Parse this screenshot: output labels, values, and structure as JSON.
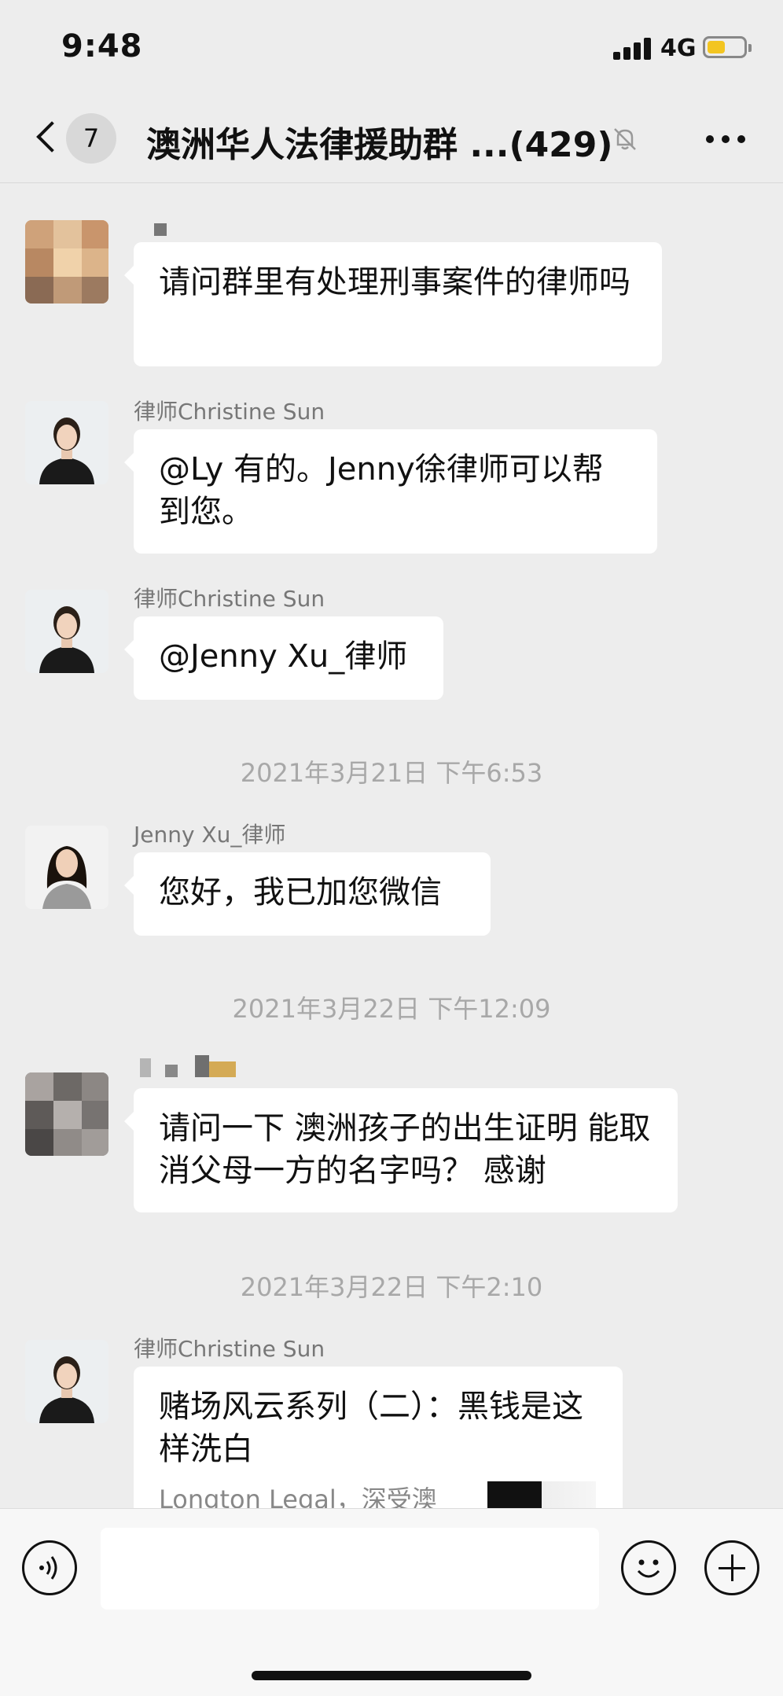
{
  "status": {
    "time": "9:48",
    "network": "4G",
    "battery_color": "#f3c521"
  },
  "header": {
    "unread_count": "7",
    "title": "澳洲华人法律援助群 ...(429)",
    "icons": [
      "back-icon",
      "bell-muted-icon",
      "more-icon"
    ]
  },
  "messages": [
    {
      "sender": "",
      "text": "请问群里有处理刑事案件的律师吗"
    },
    {
      "sender": "律师Christine Sun",
      "text": "@Ly 有的。Jenny徐律师可以帮到您。"
    },
    {
      "sender": "律师Christine Sun",
      "text": "@Jenny Xu_律师"
    },
    {
      "timestamp": "2021年3月21日 下午6:53"
    },
    {
      "sender": "Jenny Xu_律师",
      "text": "您好，我已加您微信"
    },
    {
      "timestamp": "2021年3月22日 下午12:09"
    },
    {
      "sender": "",
      "text": "请问一下 澳洲孩子的出生证明 能取消父母一方的名字吗？ 感谢"
    },
    {
      "timestamp": "2021年3月22日 下午2:10"
    },
    {
      "sender": "律师Christine Sun",
      "link_title": "赌场风云系列（二）：黑钱是这样洗白",
      "link_desc": "Longton Legal，深受澳"
    }
  ],
  "input_bar": {
    "icons": [
      "voice-icon",
      "emoji-icon",
      "plus-icon"
    ]
  }
}
